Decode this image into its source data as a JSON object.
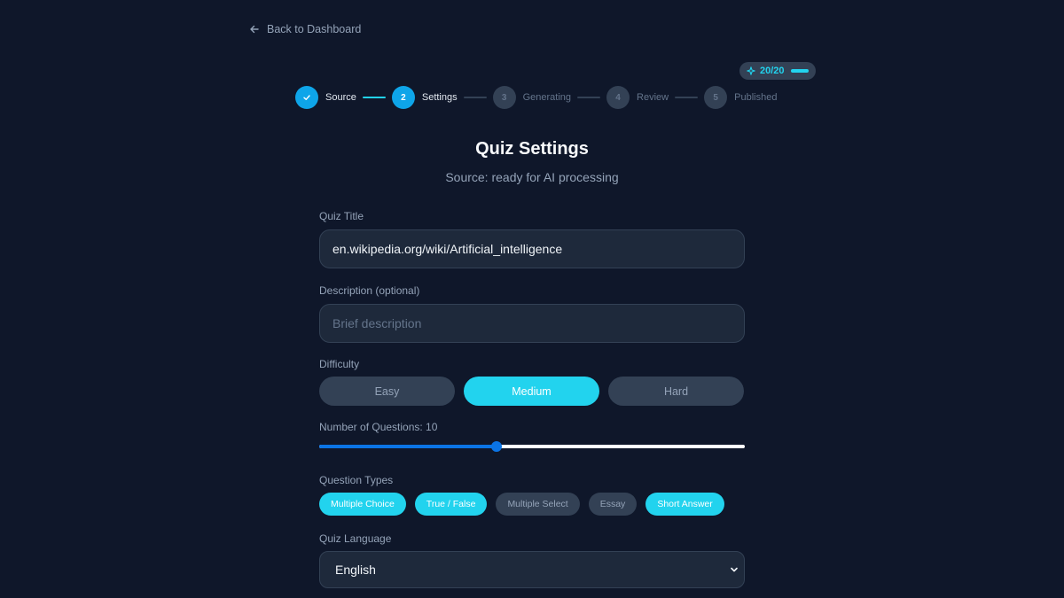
{
  "nav": {
    "back_label": "Back to Dashboard"
  },
  "credits": {
    "label": "20/20",
    "fraction": 1.0
  },
  "stepper": {
    "steps": [
      {
        "number": "",
        "label": "Source",
        "state": "done"
      },
      {
        "number": "2",
        "label": "Settings",
        "state": "current"
      },
      {
        "number": "3",
        "label": "Generating",
        "state": "todo"
      },
      {
        "number": "4",
        "label": "Review",
        "state": "todo"
      },
      {
        "number": "5",
        "label": "Published",
        "state": "todo"
      }
    ]
  },
  "header": {
    "title": "Quiz Settings",
    "subtitle": "Source: ready for AI processing"
  },
  "form": {
    "quiz_title": {
      "label": "Quiz Title",
      "value": "en.wikipedia.org/wiki/Artificial_intelligence"
    },
    "description": {
      "label": "Description (optional)",
      "placeholder": "Brief description",
      "value": ""
    },
    "difficulty": {
      "label": "Difficulty",
      "options": [
        "Easy",
        "Medium",
        "Hard"
      ],
      "selected": "Medium"
    },
    "questions": {
      "label": "Number of Questions: 10",
      "value": 10,
      "slider_fraction": 0.416
    },
    "question_types": {
      "label": "Question Types",
      "options": [
        {
          "label": "Multiple Choice",
          "selected": true
        },
        {
          "label": "True / False",
          "selected": true
        },
        {
          "label": "Multiple Select",
          "selected": false
        },
        {
          "label": "Essay",
          "selected": false
        },
        {
          "label": "Short Answer",
          "selected": true
        }
      ]
    },
    "language": {
      "label": "Quiz Language",
      "value": "English"
    }
  },
  "colors": {
    "background": "#0f172a",
    "accent": "#22d3ee",
    "step_active": "#0ea5e9",
    "slider": "#0b74e5",
    "chip_off": "#334155"
  },
  "icons": {
    "back": "arrow-left-icon",
    "credits": "sparkle-icon",
    "step_done": "check-icon",
    "select": "chevron-down-icon"
  }
}
